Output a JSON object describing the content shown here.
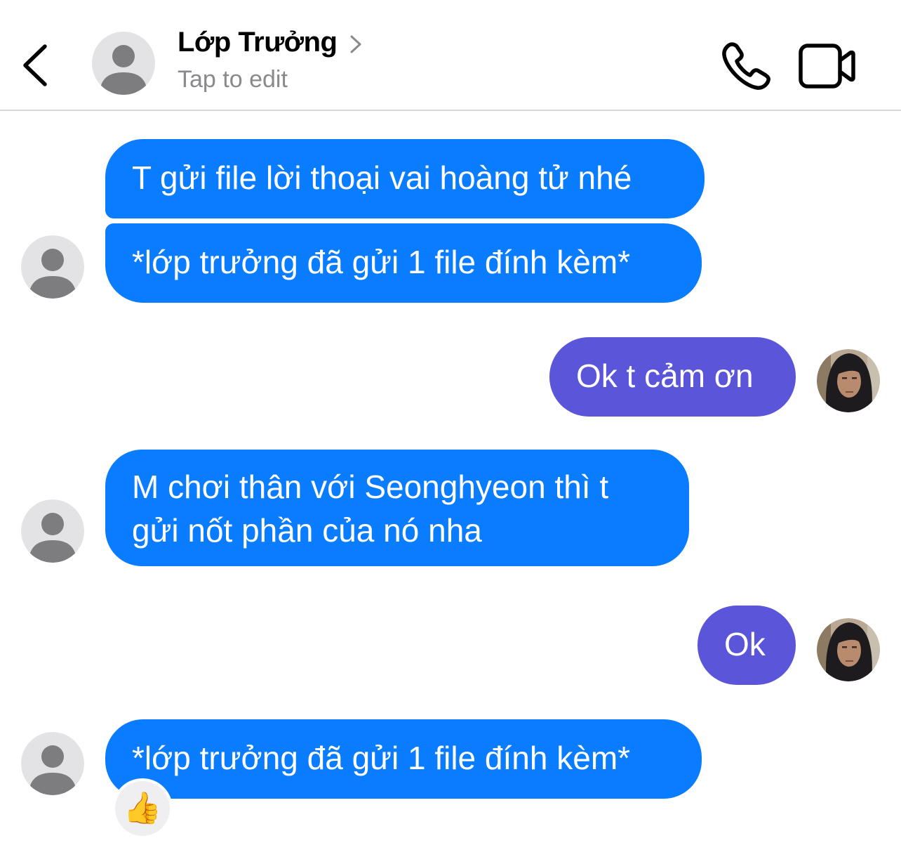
{
  "header": {
    "contact_name": "Lớp Trưởng",
    "subtitle": "Tap to edit"
  },
  "colors": {
    "incoming_bubble": "#0a7cff",
    "outgoing_bubble": "#5b55d9",
    "header_subtitle": "#8a8a8e"
  },
  "icons": {
    "back": "chevron-left-icon",
    "name_chevron": "chevron-right-icon",
    "call": "phone-icon",
    "video": "video-camera-icon",
    "avatar_placeholder": "person-silhouette-icon"
  },
  "messages": [
    {
      "direction": "incoming",
      "lines": [
        "T gửi file lời thoại vai hoàng tử nhé"
      ]
    },
    {
      "direction": "incoming",
      "lines": [
        "*lớp trưởng đã gửi 1 file đính kèm*"
      ]
    },
    {
      "direction": "outgoing",
      "lines": [
        "Ok t cảm ơn"
      ]
    },
    {
      "direction": "incoming",
      "lines": [
        "M chơi thân với Seonghyeon thì t",
        "gửi nốt phần của nó nha"
      ]
    },
    {
      "direction": "outgoing",
      "lines": [
        "Ok"
      ]
    },
    {
      "direction": "incoming",
      "lines": [
        "*lớp trưởng đã gửi 1 file đính kèm*"
      ],
      "reaction": "👍"
    }
  ]
}
